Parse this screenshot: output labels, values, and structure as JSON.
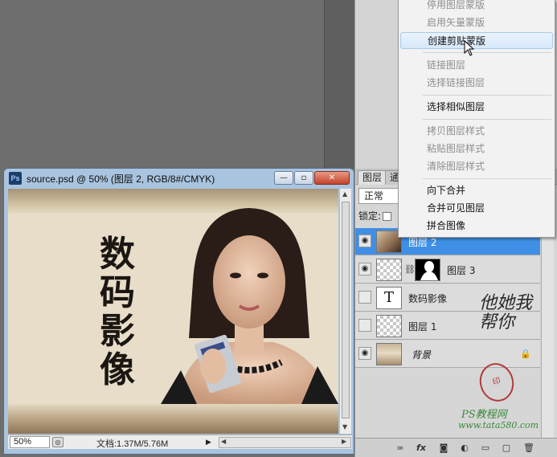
{
  "document": {
    "title": "source.psd @ 50% (图层 2, RGB/8#/CMYK)",
    "app_icon_label": "Ps",
    "zoom": "50%",
    "doc_size": "文档:1.37M/5.76M",
    "canvas_calligraphy": [
      "数",
      "码",
      "影",
      "像"
    ],
    "buttons": {
      "minimize": "—",
      "maximize": "▫",
      "close": "✕"
    }
  },
  "layers_panel": {
    "tabs": [
      "图层",
      "通"
    ],
    "blend_mode": "正常",
    "lock_label": "锁定:",
    "layers": [
      {
        "name": "图层 2",
        "visible": true,
        "selected": true,
        "thumb": "photo"
      },
      {
        "name": "图层 3",
        "visible": true,
        "selected": false,
        "thumb": "mask"
      },
      {
        "name": "数码影像",
        "visible": false,
        "selected": false,
        "thumb": "text",
        "thumb_glyph": "T"
      },
      {
        "name": "图层 1",
        "visible": false,
        "selected": false,
        "thumb": "check"
      },
      {
        "name": "背景",
        "visible": true,
        "selected": false,
        "thumb": "background",
        "locked": true
      }
    ],
    "footer_icons": [
      "link-icon",
      "fx-icon",
      "mask-icon",
      "adjustment-icon",
      "folder-icon",
      "new-layer-icon",
      "trash-icon"
    ],
    "footer_glyphs": {
      "link": "∞",
      "fx": "fx",
      "mask": "◙",
      "adjust": "◐",
      "folder": "▭",
      "new": "▢",
      "trash": "🗑"
    }
  },
  "context_menu": {
    "items": [
      {
        "label": "停用图层蒙版",
        "state": "disabled"
      },
      {
        "label": "启用矢量蒙版",
        "state": "disabled"
      },
      {
        "label": "创建剪贴蒙版",
        "state": "hover"
      },
      {
        "label": "链接图层",
        "state": "disabled"
      },
      {
        "label": "选择链接图层",
        "state": "disabled"
      },
      {
        "label": "选择相似图层",
        "state": "enabled"
      },
      {
        "label": "拷贝图层样式",
        "state": "disabled"
      },
      {
        "label": "粘贴图层样式",
        "state": "disabled"
      },
      {
        "label": "清除图层样式",
        "state": "disabled"
      },
      {
        "label": "向下合并",
        "state": "enabled"
      },
      {
        "label": "合并可见图层",
        "state": "enabled"
      },
      {
        "label": "拼合图像",
        "state": "enabled"
      }
    ]
  },
  "watermark": {
    "calligraphy": "他她我帮你",
    "seal": "印",
    "site_name": "PS教程网",
    "url": "www.tata580.com"
  },
  "colors": {
    "selection": "#3f8fe6",
    "menu_hover": "#d6e8fa",
    "watermark_green": "#3a8a3a",
    "seal_red": "#b43b3b"
  }
}
